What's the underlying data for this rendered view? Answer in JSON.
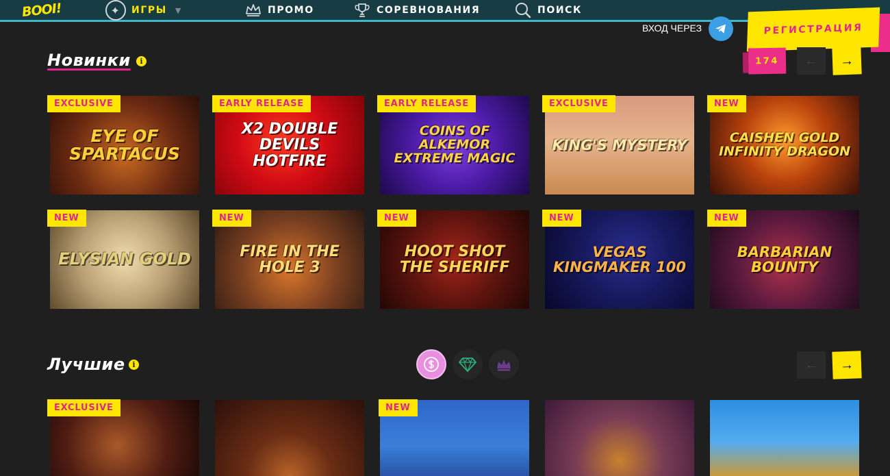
{
  "brand": {
    "logo": "BOOI!"
  },
  "nav": {
    "games": "ИГРЫ",
    "promo": "ПРОМО",
    "competitions": "СОРЕВНОВАНИЯ",
    "search": "ПОИСК"
  },
  "auth": {
    "login_via": "ВХОД ЧЕРЕЗ",
    "register": "РЕГИСТРАЦИЯ"
  },
  "new_section": {
    "title": "Новинки",
    "info": "i",
    "count": "174",
    "next": "→",
    "prev": "←",
    "games": [
      {
        "badge": "EXCLUSIVE",
        "name": "Eye of Spartacus"
      },
      {
        "badge": "EARLY RELEASE",
        "name": "x2 Double Devils Hotfire"
      },
      {
        "badge": "EARLY RELEASE",
        "name": "Coins of Alkemor Extreme Magic"
      },
      {
        "badge": "EXCLUSIVE",
        "name": "King's Mystery"
      },
      {
        "badge": "NEW",
        "name": "Caishen Gold Infinity Dragon"
      },
      {
        "badge": "NEW",
        "name": "Elysian Gold"
      },
      {
        "badge": "NEW",
        "name": "Fire in the Hole 3"
      },
      {
        "badge": "NEW",
        "name": "Hoot Shot the Sheriff"
      },
      {
        "badge": "NEW",
        "name": "Vegas Kingmaker 100"
      },
      {
        "badge": "NEW",
        "name": "Barbarian Bounty"
      }
    ]
  },
  "best_section": {
    "title": "Лучшие",
    "info": "i",
    "next": "→",
    "prev": "←",
    "filters": [
      "dollar-icon",
      "gem-icon",
      "crown-icon"
    ],
    "games": [
      {
        "badge": "EXCLUSIVE"
      },
      {
        "badge": ""
      },
      {
        "badge": "NEW"
      },
      {
        "badge": ""
      },
      {
        "badge": ""
      }
    ]
  }
}
